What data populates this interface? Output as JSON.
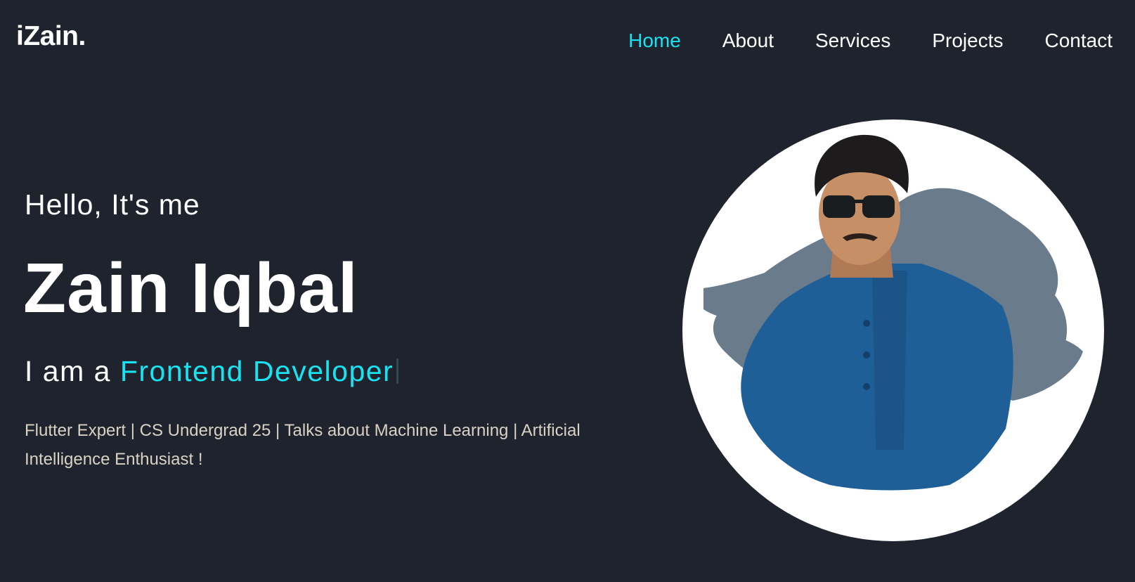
{
  "header": {
    "logo": "iZain.",
    "nav": [
      {
        "label": "Home",
        "active": true
      },
      {
        "label": "About",
        "active": false
      },
      {
        "label": "Services",
        "active": false
      },
      {
        "label": "Projects",
        "active": false
      },
      {
        "label": "Contact",
        "active": false
      }
    ]
  },
  "hero": {
    "greeting": "Hello, It's me",
    "name": "Zain Iqbal",
    "role_prefix": "I am a ",
    "role_highlight": "Frontend Developer",
    "bio": "Flutter Expert | CS Undergrad 25 | Talks about Machine Learning | Artificial Intelligence Enthusiast !"
  },
  "profile_image": {
    "icon": "profile-photo"
  },
  "colors": {
    "background": "#1f232d",
    "accent": "#19e3f0",
    "text": "#ffffff",
    "muted_text": "#d9d2c4"
  }
}
